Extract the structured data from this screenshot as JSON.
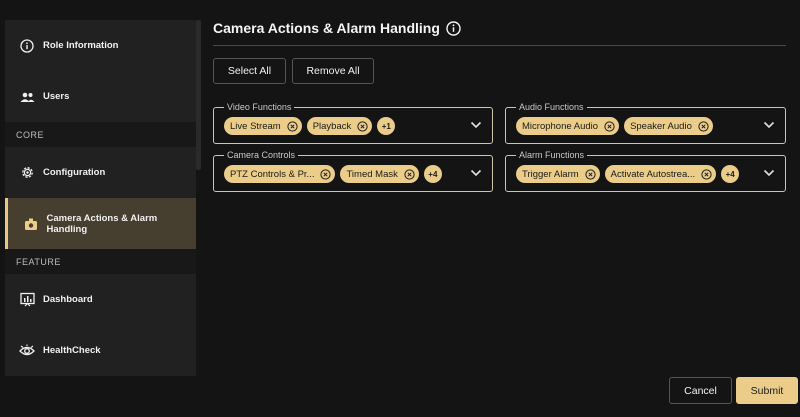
{
  "sidebar": {
    "items_top": [
      {
        "label": "Role Information",
        "icon": "info-icon"
      },
      {
        "label": "Users",
        "icon": "users-icon"
      }
    ],
    "section_core": "CORE",
    "items_core": [
      {
        "label": "Configuration",
        "icon": "gear-icon"
      },
      {
        "label": "Camera Actions & Alarm Handling",
        "icon": "camera-alarm-icon",
        "active": true
      }
    ],
    "section_feature": "FEATURE",
    "items_feature": [
      {
        "label": "Dashboard",
        "icon": "dashboard-icon"
      },
      {
        "label": "HealthCheck",
        "icon": "eye-icon"
      }
    ]
  },
  "main": {
    "title": "Camera Actions & Alarm Handling",
    "select_all": "Select All",
    "remove_all": "Remove All",
    "fields": {
      "video": {
        "legend": "Video Functions",
        "chips": [
          "Live Stream",
          "Playback"
        ],
        "more": "+1"
      },
      "audio": {
        "legend": "Audio Functions",
        "chips": [
          "Microphone Audio",
          "Speaker Audio"
        ],
        "more": ""
      },
      "camera": {
        "legend": "Camera Controls",
        "chips": [
          "PTZ Controls & Pr...",
          "Timed Mask"
        ],
        "more": "+4"
      },
      "alarm": {
        "legend": "Alarm Functions",
        "chips": [
          "Trigger Alarm",
          "Activate Autostrea..."
        ],
        "more": "+4"
      }
    },
    "cancel": "Cancel",
    "submit": "Submit"
  },
  "colors": {
    "accent": "#ebcd89",
    "active_bg": "#463e2e",
    "background": "#141414"
  }
}
